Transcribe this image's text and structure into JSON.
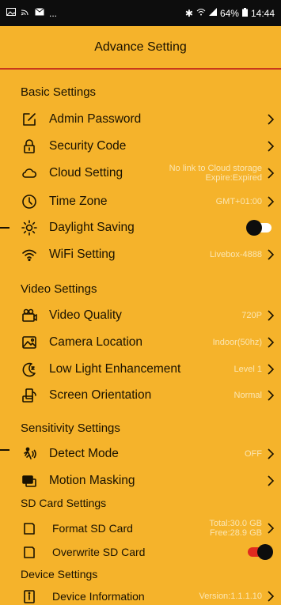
{
  "status_bar": {
    "left_icons": [
      "gallery-icon",
      "cast-icon",
      "mail-icon"
    ],
    "dots": "...",
    "bluetooth": "✱",
    "battery_text": "64%",
    "time": "14:44"
  },
  "header": {
    "title": "Advance Setting"
  },
  "sections": {
    "basic": "Basic Settings",
    "video": "Video Settings",
    "sensitivity": "Sensitivity Settings",
    "sd": "SD Card Settings",
    "device": "Device Settings"
  },
  "rows": {
    "admin_password": {
      "label": "Admin Password",
      "icon": "edit-icon"
    },
    "security_code": {
      "label": "Security Code",
      "icon": "lock-icon"
    },
    "cloud_setting": {
      "label": "Cloud Setting",
      "icon": "cloud-icon",
      "value_line1": "No link to Cloud storage",
      "value_line2": "Expire:Expired"
    },
    "time_zone": {
      "label": "Time Zone",
      "icon": "clock-icon",
      "value": "GMT+01:00"
    },
    "daylight_saving": {
      "label": "Daylight Saving",
      "icon": "sun-icon",
      "toggle": "off"
    },
    "wifi_setting": {
      "label": "WiFi Setting",
      "icon": "wifi-icon",
      "value": "Livebox-4888"
    },
    "video_quality": {
      "label": "Video Quality",
      "icon": "video-quality-icon",
      "value": "720P"
    },
    "camera_location": {
      "label": "Camera Location",
      "icon": "image-icon",
      "value": "Indoor(50hz)"
    },
    "low_light": {
      "label": "Low Light Enhancement",
      "icon": "moon-icon",
      "value": "Level 1"
    },
    "screen_orientation": {
      "label": "Screen Orientation",
      "icon": "rotate-icon",
      "value": "Normal"
    },
    "detect_mode": {
      "label": "Detect Mode",
      "icon": "motion-icon",
      "value": "OFF"
    },
    "motion_masking": {
      "label": "Motion Masking",
      "icon": "mask-icon"
    },
    "format_sd": {
      "label": "Format SD Card",
      "icon": "sd-icon",
      "value_line1": "Total:30.0 GB",
      "value_line2": "Free:28.9 GB"
    },
    "overwrite_sd": {
      "label": "Overwrite SD Card",
      "icon": "sd-icon",
      "toggle": "on"
    },
    "device_info": {
      "label": "Device Information",
      "icon": "info-icon",
      "value": "Version:1.1.1.10"
    }
  },
  "colors": {
    "background": "#f5b32b",
    "header_divider": "#c8381d",
    "toggle_on": "#e02b1f",
    "value_text": "#fbe6b2"
  }
}
